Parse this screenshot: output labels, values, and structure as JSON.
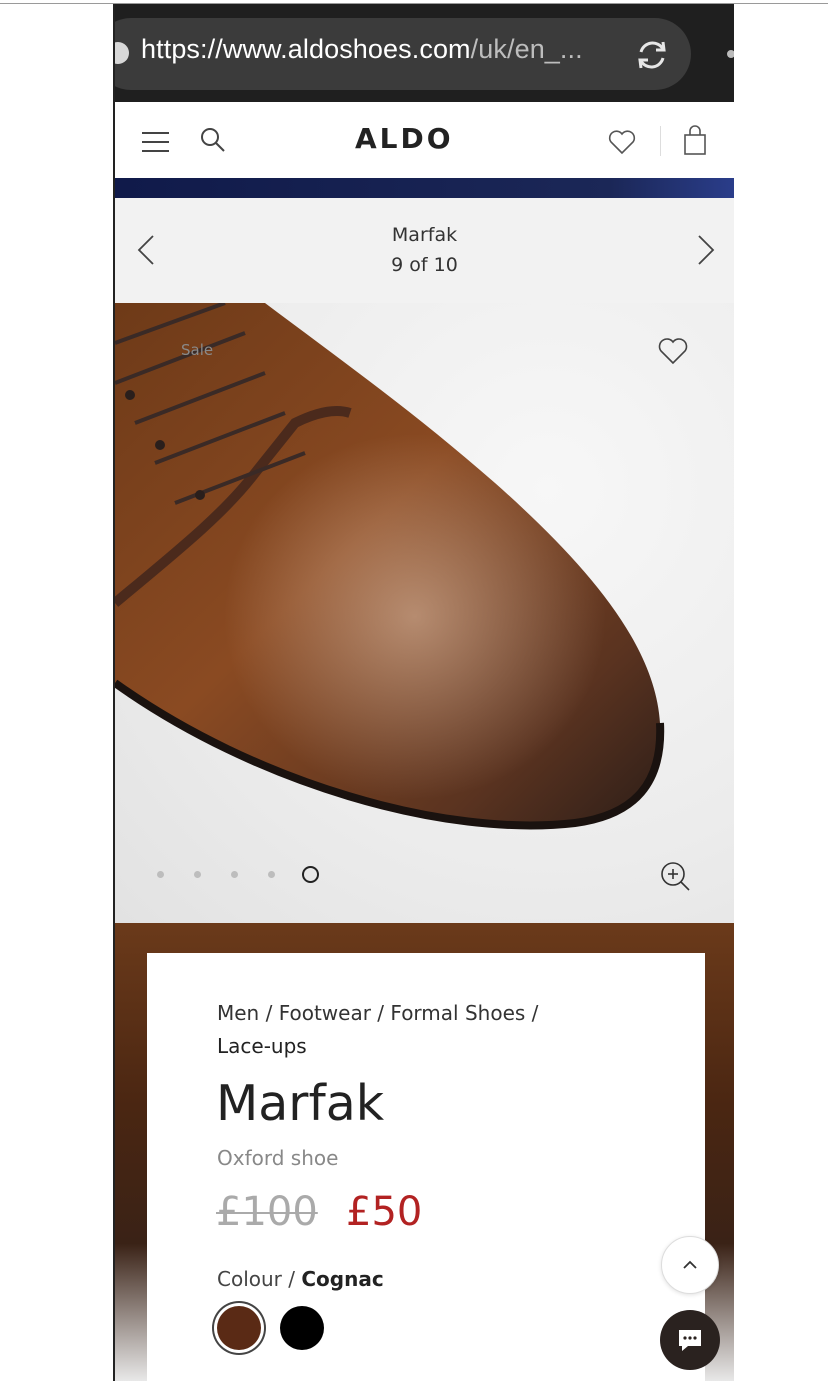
{
  "browser": {
    "url_host": "https://www.aldoshoes.com",
    "url_path": "/uk/en_...",
    "reload_icon": "reload-icon"
  },
  "header": {
    "logo": "ALDO",
    "menu_icon": "hamburger-icon",
    "search_icon": "search-icon",
    "wishlist_icon": "heart-icon",
    "bag_icon": "shopping-bag-icon"
  },
  "product_nav": {
    "name": "Marfak",
    "position": "9 of 10"
  },
  "image": {
    "badge": "Sale",
    "dots_total": 5,
    "active_dot_index": 4
  },
  "product": {
    "breadcrumb": [
      "Men",
      "Footwear",
      "Formal Shoes",
      "Lace-ups"
    ],
    "breadcrumb_sep": " / ",
    "title": "Marfak",
    "subtitle": "Oxford shoe",
    "old_price": "£100",
    "new_price": "£50",
    "colour_label": "Colour / ",
    "colour_value": "Cognac",
    "swatches": [
      {
        "name": "Cognac",
        "color": "#5a2a15",
        "selected": true
      },
      {
        "name": "Black",
        "color": "#000000",
        "selected": false
      }
    ]
  },
  "colors": {
    "sale_price": "#b22222",
    "promo_strip": "#101a4a",
    "chat_bg": "#2a221f"
  }
}
